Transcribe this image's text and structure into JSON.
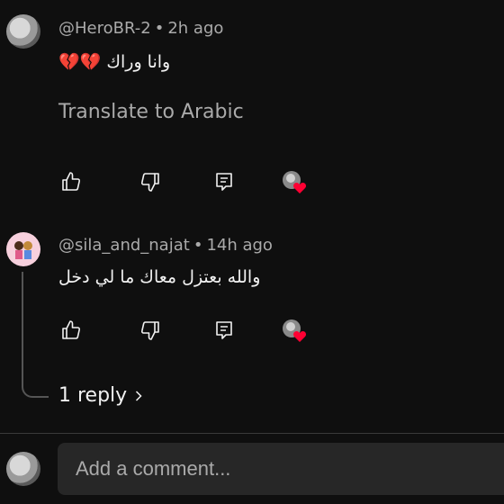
{
  "comments": [
    {
      "username": "@HeroBR-2",
      "time": "2h ago",
      "text": "وانا وراك 💔💔",
      "translate_label": "Translate to Arabic"
    },
    {
      "username": "@sila_and_najat",
      "time": "14h ago",
      "text": "والله بعتزل معاك ما لي دخل",
      "reply_label": "1 reply"
    }
  ],
  "composer": {
    "placeholder": "Add a comment..."
  },
  "colors": {
    "background": "#0f0f0f",
    "secondary_text": "#aaaaaa",
    "heart": "#ff0033",
    "input_bg": "#272727"
  },
  "icons": [
    "thumbs-up-icon",
    "thumbs-down-icon",
    "reply-icon",
    "creator-heart-icon",
    "chevron-right-icon"
  ]
}
